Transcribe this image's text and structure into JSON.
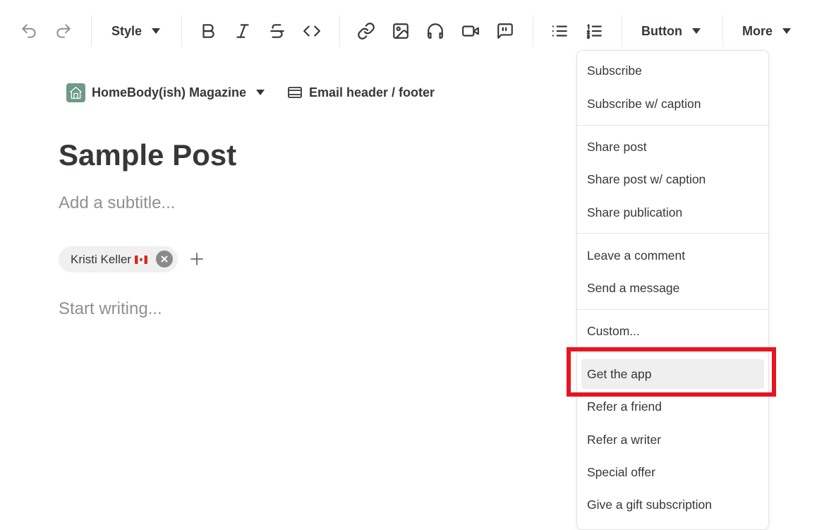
{
  "toolbar": {
    "undo_icon": "undo-icon",
    "redo_icon": "redo-icon",
    "style_label": "Style",
    "format_icons": [
      "bold-icon",
      "italic-icon",
      "strikethrough-icon",
      "code-icon"
    ],
    "insert_icons": [
      "link-icon",
      "image-icon",
      "audio-icon",
      "video-icon",
      "quote-icon"
    ],
    "list_icons": [
      "bullet-list-icon",
      "numbered-list-icon"
    ],
    "button_label": "Button",
    "more_label": "More"
  },
  "publication": {
    "name": "HomeBody(ish) Magazine",
    "logo_icon": "house-logo",
    "logo_color": "#6f9b86",
    "email_header_footer_label": "Email header / footer"
  },
  "post": {
    "title": "Sample Post",
    "subtitle_placeholder": "Add a subtitle...",
    "author": {
      "name": "Kristi Keller",
      "flag_icon": "canada-flag-icon"
    },
    "body_placeholder": "Start writing..."
  },
  "more_menu": {
    "groups": [
      [
        "Subscribe",
        "Subscribe w/ caption"
      ],
      [
        "Share post",
        "Share post w/ caption",
        "Share publication"
      ],
      [
        "Leave a comment",
        "Send a message"
      ],
      [
        "Custom..."
      ],
      [
        "Get the app",
        "Refer a friend",
        "Refer a writer",
        "Special offer",
        "Give a gift subscription"
      ]
    ],
    "hovered_item": "Get the app",
    "highlight_color": "#e8141f"
  }
}
